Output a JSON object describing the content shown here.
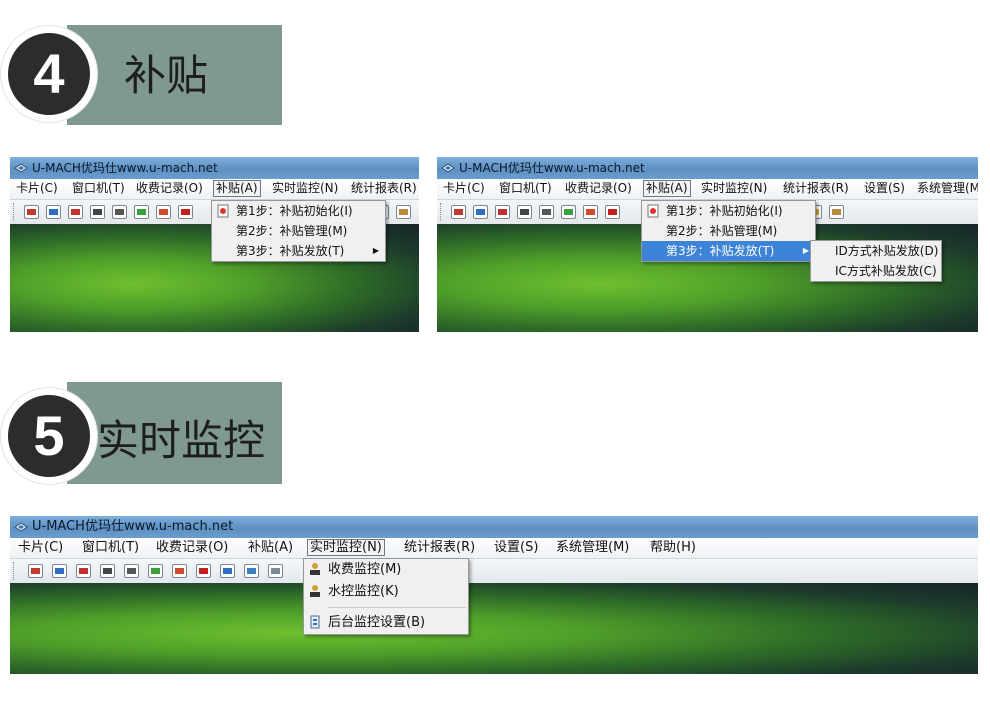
{
  "steps": [
    {
      "number": "4",
      "title": "补贴",
      "screens": [
        {
          "window_title": "U-MACH优玛仕www.u-mach.net",
          "menubar": [
            "卡片(C)",
            "窗口机(T)",
            "收费记录(O)",
            "补贴(A)",
            "实时监控(N)",
            "统计报表(R)"
          ],
          "menu": [
            "第1步：补贴初始化(I)",
            "第2步：补贴管理(M)",
            "第3步：补贴发放(T)"
          ]
        },
        {
          "window_title": "U-MACH优玛仕www.u-mach.net",
          "menubar": [
            "卡片(C)",
            "窗口机(T)",
            "收费记录(O)",
            "补贴(A)",
            "实时监控(N)",
            "统计报表(R)",
            "设置(S)",
            "系统管理(M"
          ],
          "menu": [
            "第1步：补贴初始化(I)",
            "第2步：补贴管理(M)",
            "第3步：补贴发放(T)"
          ],
          "submenu": [
            "ID方式补贴发放(D)",
            "IC方式补贴发放(C)"
          ]
        }
      ]
    },
    {
      "number": "5",
      "title": "实时监控",
      "screens": [
        {
          "window_title": "U-MACH优玛仕www.u-mach.net",
          "menubar": [
            "卡片(C)",
            "窗口机(T)",
            "收费记录(O)",
            "补贴(A)",
            "实时监控(N)",
            "统计报表(R)",
            "设置(S)",
            "系统管理(M)",
            "帮助(H)"
          ],
          "menu": [
            "收费监控(M)",
            "水控监控(K)",
            "后台监控设置(B)"
          ]
        }
      ]
    }
  ],
  "colors": {
    "step_block": "#7f9892",
    "circle": "#2c2c2c",
    "menu_highlight": "#3d84d8",
    "titlebar": "#5d8fc2"
  },
  "icons": [
    "app-icon",
    "toolbar-icons",
    "subsidy-doc-icon",
    "monitor-person-icon",
    "settings-doc-icon",
    "submenu-arrow-icon"
  ]
}
